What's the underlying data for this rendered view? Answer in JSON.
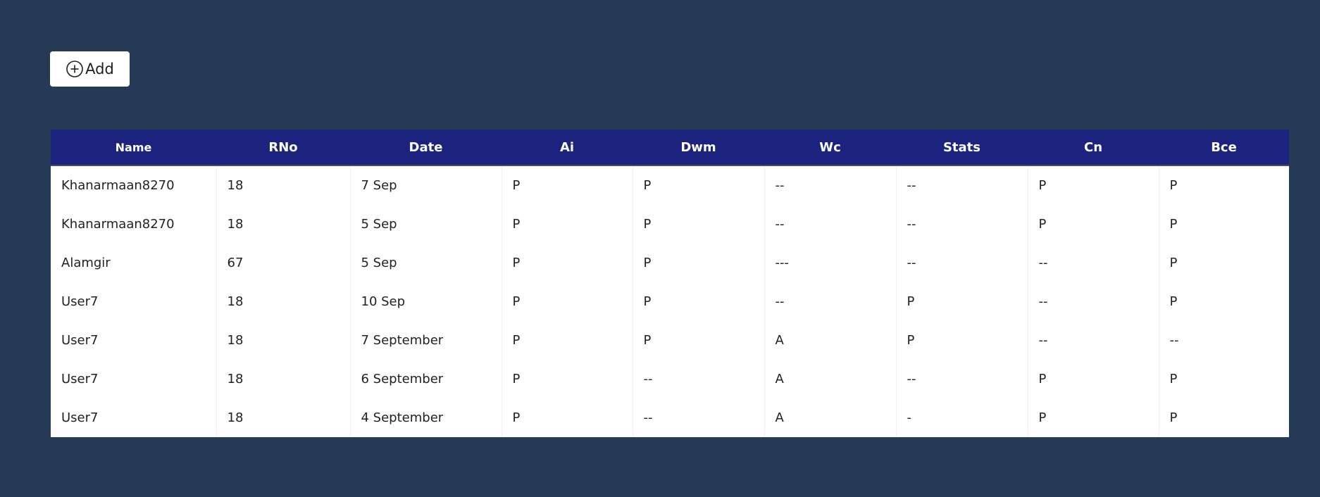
{
  "toolbar": {
    "add_label": "Add",
    "add_icon": "plus-circle-icon"
  },
  "table": {
    "columns": [
      "Name",
      "RNo",
      "Date",
      "Ai",
      "Dwm",
      "Wc",
      "Stats",
      "Cn",
      "Bce"
    ],
    "rows": [
      [
        "Khanarmaan8270",
        "18",
        "7 Sep",
        "P",
        "P",
        "--",
        "--",
        "P",
        "P"
      ],
      [
        "Khanarmaan8270",
        "18",
        "5 Sep",
        "P",
        "P",
        "--",
        "--",
        "P",
        "P"
      ],
      [
        "Alamgir",
        "67",
        "5 Sep",
        "P",
        "P",
        "---",
        "--",
        "--",
        "P"
      ],
      [
        "User7",
        "18",
        "10 Sep",
        "P",
        "P",
        "--",
        "P",
        "--",
        "P"
      ],
      [
        "User7",
        "18",
        "7 September",
        "P",
        "P",
        "A",
        "P",
        "--",
        "--"
      ],
      [
        "User7",
        "18",
        "6 September",
        "P",
        "--",
        "A",
        "--",
        "P",
        "P"
      ],
      [
        "User7",
        "18",
        "4 September",
        "P",
        "--",
        "A",
        "-",
        "P",
        "P"
      ]
    ]
  },
  "colors": {
    "background": "#253a55",
    "header_background": "#1b237f",
    "header_text": "#ffffff",
    "table_background": "#ffffff"
  }
}
